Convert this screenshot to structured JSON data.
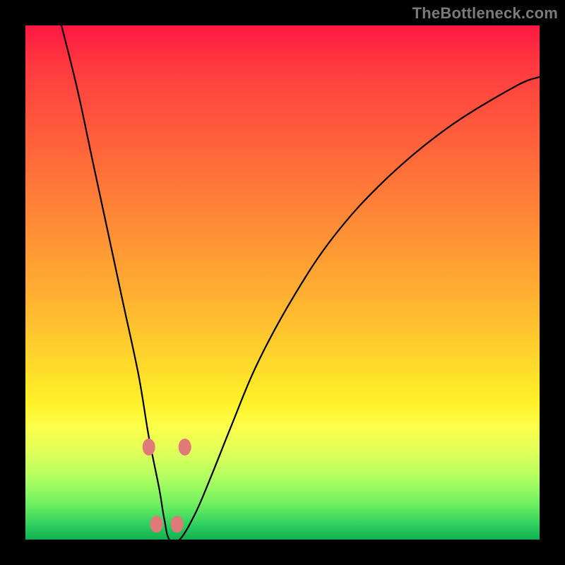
{
  "watermark": "TheBottleneck.com",
  "chart_data": {
    "type": "line",
    "title": "",
    "xlabel": "",
    "ylabel": "",
    "xlim": [
      0,
      100
    ],
    "ylim": [
      0,
      100
    ],
    "background_gradient": {
      "orientation": "vertical",
      "stops": [
        {
          "pos": 0,
          "color": "#ff1744"
        },
        {
          "pos": 20,
          "color": "#ff5a3c"
        },
        {
          "pos": 44,
          "color": "#ff9a34"
        },
        {
          "pos": 66,
          "color": "#ffda2c"
        },
        {
          "pos": 78,
          "color": "#fcff4a"
        },
        {
          "pos": 88,
          "color": "#b0ff60"
        },
        {
          "pos": 100,
          "color": "#10b050"
        }
      ]
    },
    "series": [
      {
        "name": "bottleneck-curve",
        "x": [
          7,
          10,
          13,
          16,
          19,
          22,
          24,
          26,
          27,
          28,
          30,
          33,
          36,
          40,
          45,
          52,
          60,
          70,
          82,
          95,
          100
        ],
        "values": [
          100,
          88,
          74,
          60,
          46,
          32,
          20,
          10,
          4,
          0,
          0,
          5,
          12,
          22,
          34,
          47,
          59,
          70,
          80,
          88,
          90
        ]
      }
    ],
    "markers": [
      {
        "x": 24.0,
        "y": 18
      },
      {
        "x": 31.0,
        "y": 18
      },
      {
        "x": 25.5,
        "y": 3
      },
      {
        "x": 29.5,
        "y": 3
      }
    ],
    "marker_color": "#e07a78"
  }
}
